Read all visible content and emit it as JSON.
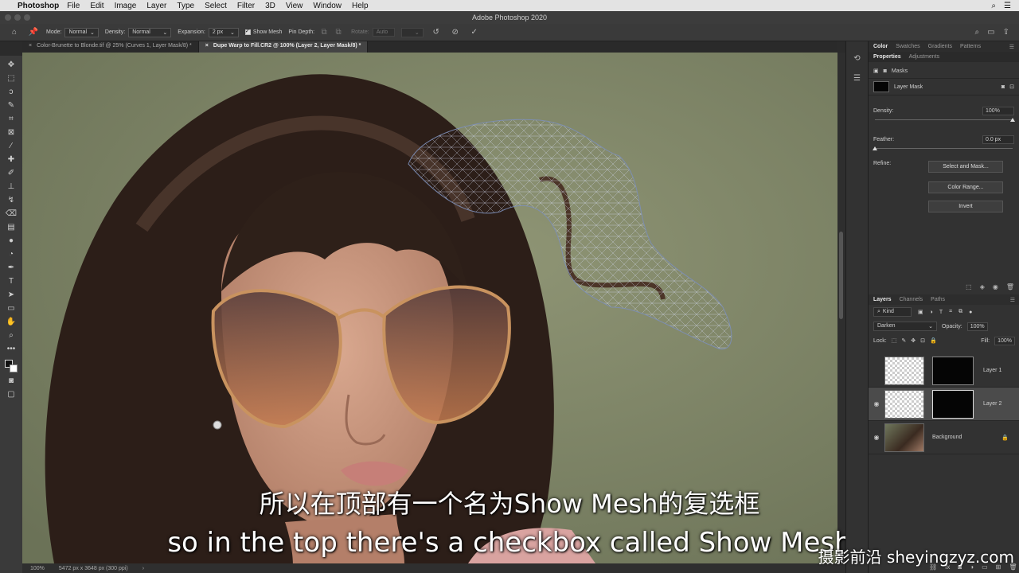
{
  "menubar": {
    "app": "Photoshop",
    "items": [
      "File",
      "Edit",
      "Image",
      "Layer",
      "Type",
      "Select",
      "Filter",
      "3D",
      "View",
      "Window",
      "Help"
    ]
  },
  "window": {
    "title": "Adobe Photoshop 2020"
  },
  "options": {
    "mode_label": "Mode:",
    "mode_value": "Normal",
    "density_label": "Density:",
    "density_value": "Normal",
    "expansion_label": "Expansion:",
    "expansion_value": "2 px",
    "show_mesh_label": "Show Mesh",
    "show_mesh_checked": true,
    "pin_depth_label": "Pin Depth:",
    "rotate_label": "Rotate:",
    "rotate_value": "Auto"
  },
  "tabs": [
    {
      "label": "Color-Brunette to  Blonde.tif @ 25% (Curves 1, Layer Mask/8) *",
      "active": false
    },
    {
      "label": "Dupe Warp to Fill.CR2 @ 100% (Layer 2, Layer Mask/8) *",
      "active": true
    }
  ],
  "panel_top": {
    "tabs": [
      "Color",
      "Swatches",
      "Gradients",
      "Patterns"
    ],
    "active": "Color"
  },
  "properties": {
    "tabs": [
      "Properties",
      "Adjustments"
    ],
    "active": "Properties",
    "masks_label": "Masks",
    "layer_mask_label": "Layer Mask",
    "density_label": "Density:",
    "density_value": "100%",
    "density_fraction": 1.0,
    "feather_label": "Feather:",
    "feather_value": "0.0 px",
    "feather_fraction": 0.0,
    "refine_label": "Refine:",
    "buttons": [
      "Select and Mask...",
      "Color Range...",
      "Invert"
    ]
  },
  "layers_panel": {
    "tabs": [
      "Layers",
      "Channels",
      "Paths"
    ],
    "active": "Layers",
    "kind_label": "Kind",
    "blend_mode": "Darken",
    "opacity_label": "Opacity:",
    "opacity_value": "100%",
    "lock_label": "Lock:",
    "fill_label": "Fill:",
    "fill_value": "100%",
    "layers": [
      {
        "name": "Layer 1",
        "visible": false,
        "selected": false
      },
      {
        "name": "Layer 2",
        "visible": true,
        "selected": true
      },
      {
        "name": "Background",
        "visible": true,
        "selected": false
      }
    ]
  },
  "status": {
    "zoom": "100%",
    "doc_info": "5472 px x 3648 px (300 ppi)"
  },
  "subtitles": {
    "zh": "所以在顶部有一个名为Show Mesh的复选框",
    "en": "so in the top there's a checkbox called Show Mesh"
  },
  "watermark": "摄影前沿 sheyingzyz.com",
  "icons": {
    "home": "home-icon",
    "tool": "puppet-warp-icon",
    "undo": "undo-icon",
    "cancel": "cancel-icon",
    "commit": "commit-icon",
    "search": "search-icon",
    "workspace": "workspace-icon",
    "share": "share-icon"
  }
}
